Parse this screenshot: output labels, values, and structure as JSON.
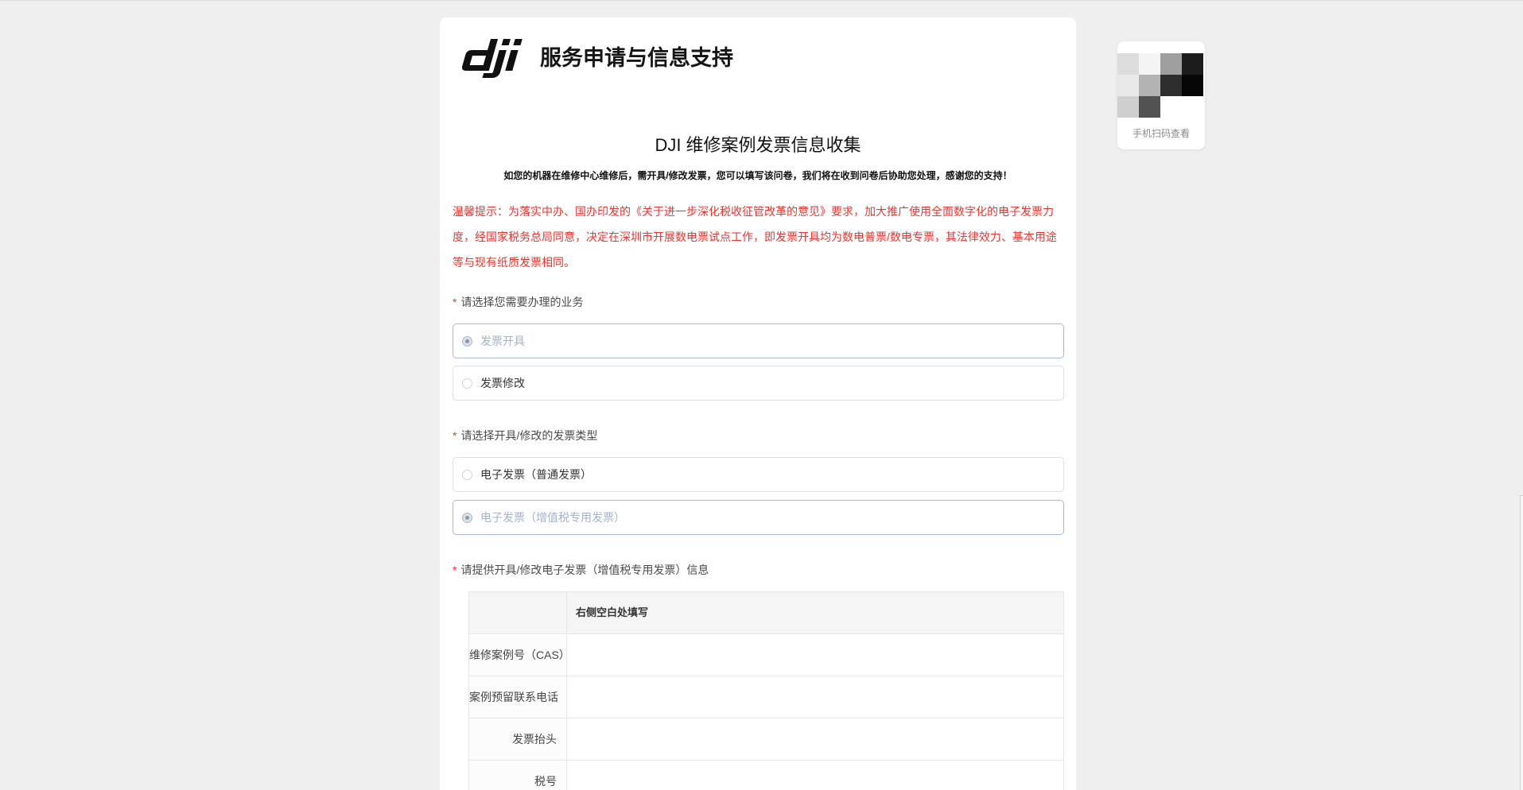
{
  "header": {
    "logo_text": "dji",
    "title": "服务申请与信息支持"
  },
  "form": {
    "title": "DJI 维修案例发票信息收集",
    "subtitle": "如您的机器在维修中心维修后，需开具/修改发票，您可以填写该问卷，我们将在收到问卷后协助您处理，感谢您的支持！",
    "notice_lines": [
      "温馨提示：为落实中办、国办印发的《关于进一步深化税收征管改革的意见》要求，加大推广使用全面数字化的电子发票力",
      "度，经国家税务总局同意，决定在深圳市开展数电票试点工作，即发票开具均为数电普票/数电专票，其法律效力、基本用途",
      "等与现有纸质发票相同。"
    ],
    "questions": [
      {
        "required_mark": "*",
        "label": "请选择您需要办理的业务",
        "options": [
          {
            "label": "发票开具",
            "selected": true
          },
          {
            "label": "发票修改",
            "selected": false
          }
        ]
      },
      {
        "required_mark": "*",
        "label": "请选择开具/修改的发票类型",
        "options": [
          {
            "label": "电子发票（普通发票）",
            "selected": false
          },
          {
            "label": "电子发票（增值税专用发票）",
            "selected": true
          }
        ]
      },
      {
        "required_mark": "*",
        "label": "请提供开具/修改电子发票（增值税专用发票）信息",
        "table": {
          "value_column_header": "右侧空白处填写",
          "rows": [
            {
              "label": "维修案例号（CAS）",
              "value": ""
            },
            {
              "label": "案例预留联系电话",
              "value": ""
            },
            {
              "label": "发票抬头",
              "value": ""
            },
            {
              "label": "税号",
              "value": ""
            }
          ]
        }
      }
    ]
  },
  "qr": {
    "caption": "手机扫码查看",
    "pixels": [
      [
        "#dcdcdc",
        "#f4f4f4",
        "#9f9f9f",
        "#1c1c1c"
      ],
      [
        "#e9e9e9",
        "#b3b3b3",
        "#2e2e2e",
        "#060606"
      ],
      [
        "#cfcfcf",
        "#525252",
        "#ffffff",
        "#ffffff"
      ]
    ]
  },
  "theme": {
    "page_background": "#efefef",
    "notice_red": "#e8372f",
    "selected_border": "#a8bad0",
    "selected_text": "#a3b3c7"
  }
}
